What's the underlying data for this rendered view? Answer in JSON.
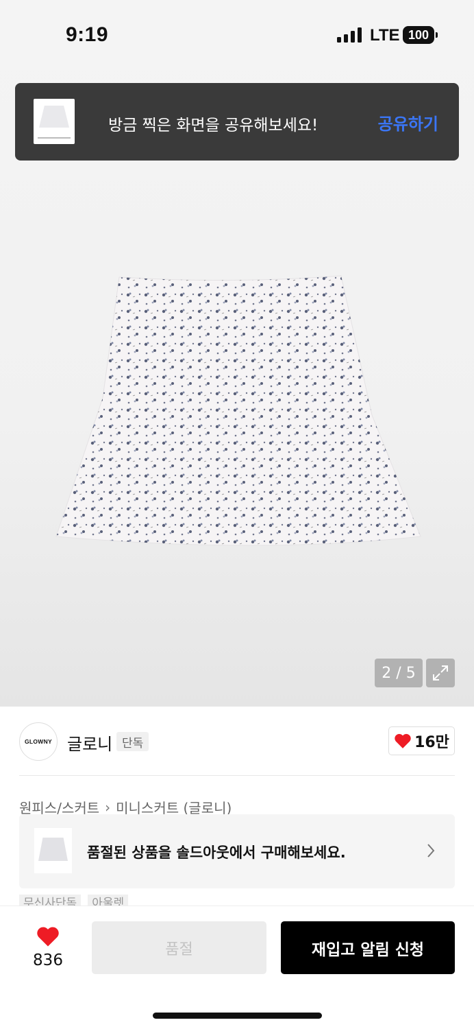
{
  "status_bar": {
    "time": "9:19",
    "network": "LTE",
    "battery": "100"
  },
  "share_toast": {
    "message": "방금 찍은 화면을 공유해보세요!",
    "action": "공유하기"
  },
  "gallery": {
    "counter": "2 / 5"
  },
  "brand": {
    "logo_text": "GLOWNY",
    "name": "글로니",
    "tag": "단독",
    "like_count": "16만"
  },
  "breadcrumb": {
    "category": "원피스/스커트",
    "subcategory": "미니스커트 (글로니)"
  },
  "soldout_banner": {
    "text": "품절된 상품을 솔드아웃에서 구매해보세요."
  },
  "tags": [
    "무신사단독",
    "아울렛"
  ],
  "bottom_bar": {
    "likes": "836",
    "soldout_label": "품절",
    "restock_label": "재입고 알림 신청"
  },
  "colors": {
    "accent_blue": "#3b76f6",
    "heart_red": "#ee1c25",
    "primary_button": "#000000"
  }
}
